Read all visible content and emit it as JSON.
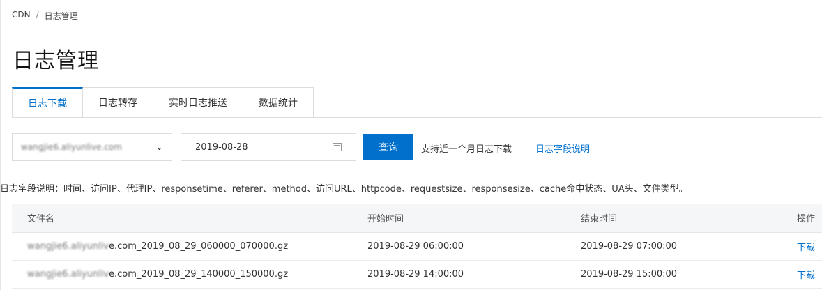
{
  "breadcrumb": {
    "root": "CDN",
    "sep": "/",
    "current": "日志管理"
  },
  "page_title": "日志管理",
  "tabs": [
    {
      "label": "日志下载",
      "active": true
    },
    {
      "label": "日志转存",
      "active": false
    },
    {
      "label": "实时日志推送",
      "active": false
    },
    {
      "label": "数据统计",
      "active": false
    }
  ],
  "filters": {
    "domain_value": "wangjie6.aliyunlive.com",
    "date_value": "2019-08-28",
    "query_label": "查询",
    "hint_text": "支持近一个月日志下载",
    "hint_link": "日志字段说明"
  },
  "field_description": "日志字段说明：时间、访问IP、代理IP、responsetime、referer、method、访问URL、httpcode、requestsize、responsesize、cache命中状态、UA头、文件类型。",
  "table": {
    "headers": {
      "name": "文件名",
      "start": "开始时间",
      "end": "结束时间",
      "op": "操作"
    },
    "rows": [
      {
        "name_host": "wangjie6.aliyunliv",
        "name_rest": "e.com_2019_08_29_060000_070000.gz",
        "start": "2019-08-29 06:00:00",
        "end": "2019-08-29 07:00:00",
        "op": "下载"
      },
      {
        "name_host": "wangjie6.aliyunliv",
        "name_rest": "e.com_2019_08_29_140000_150000.gz",
        "start": "2019-08-29 14:00:00",
        "end": "2019-08-29 15:00:00",
        "op": "下载"
      }
    ]
  },
  "colors": {
    "accent": "#0070cc",
    "header_bg": "#f5f6f8",
    "border": "#dcdcdc"
  }
}
